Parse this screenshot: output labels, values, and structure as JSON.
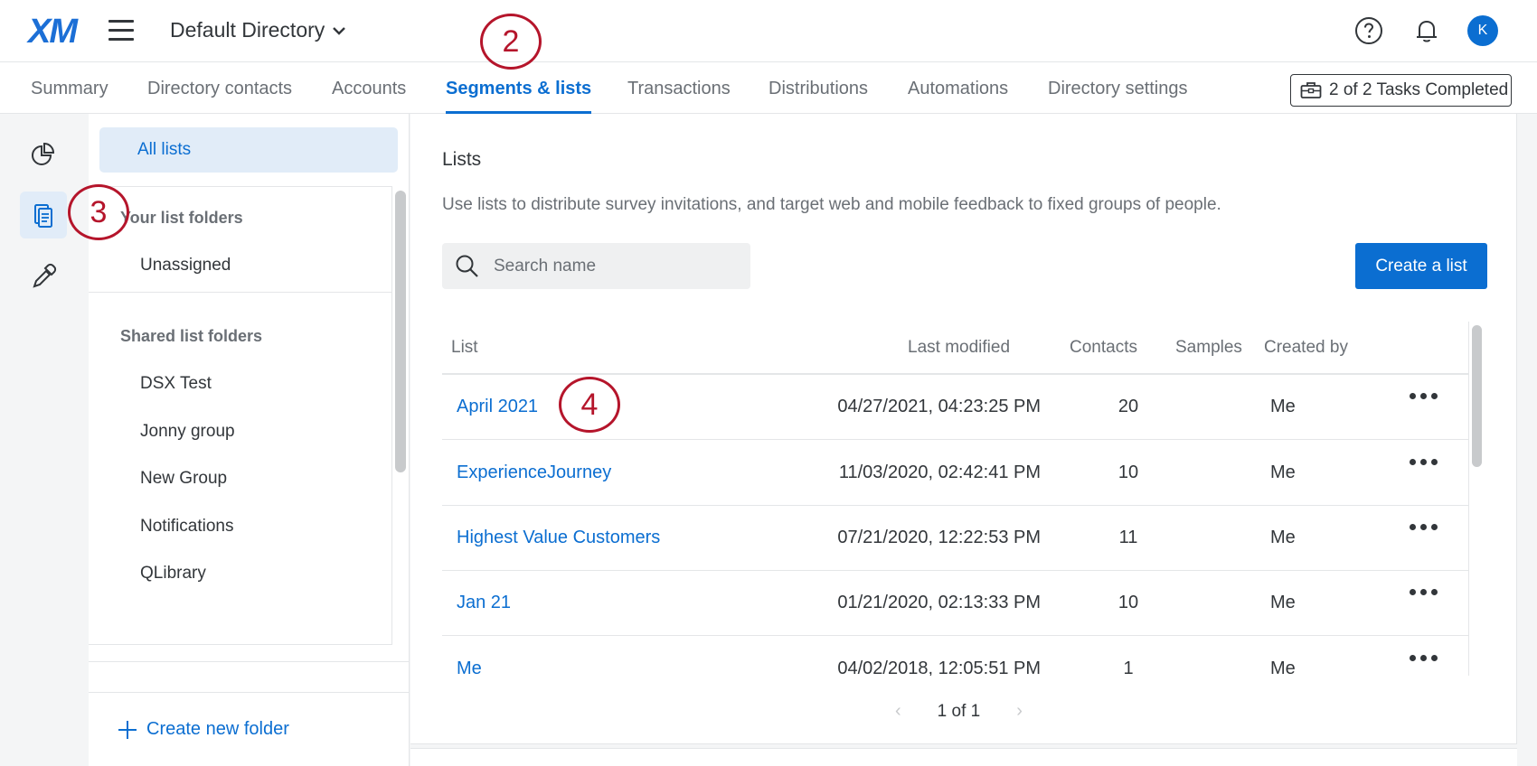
{
  "header": {
    "logo": "XM",
    "directory_name": "Default Directory",
    "avatar_initial": "K"
  },
  "tabs": [
    {
      "label": "Summary"
    },
    {
      "label": "Directory contacts"
    },
    {
      "label": "Accounts"
    },
    {
      "label": "Segments & lists",
      "active": true
    },
    {
      "label": "Transactions"
    },
    {
      "label": "Distributions"
    },
    {
      "label": "Automations"
    },
    {
      "label": "Directory settings"
    }
  ],
  "tasks_button": "2 of 2 Tasks Completed",
  "rail": {
    "items": [
      {
        "icon": "segments-pie-icon"
      },
      {
        "icon": "lists-icon",
        "active": true
      },
      {
        "icon": "eyedropper-icon"
      }
    ]
  },
  "folders": {
    "all_lists": "All lists",
    "your_heading": "Your list folders",
    "your_items": [
      "Unassigned"
    ],
    "shared_heading": "Shared list folders",
    "shared_items": [
      "DSX Test",
      "Jonny group",
      "New Group",
      "Notifications",
      "QLibrary"
    ],
    "create_folder": "Create new folder"
  },
  "main": {
    "title": "Lists",
    "description": "Use lists to distribute survey invitations, and target web and mobile feedback to fixed groups of people.",
    "search_placeholder": "Search name",
    "create_button": "Create a list",
    "columns": [
      "List",
      "Last modified",
      "Contacts",
      "Samples",
      "Created by"
    ],
    "rows": [
      {
        "name": "April 2021",
        "modified": "04/27/2021, 04:23:25 PM",
        "contacts": "20",
        "samples": "",
        "created_by": "Me"
      },
      {
        "name": "ExperienceJourney",
        "modified": "11/03/2020, 02:42:41 PM",
        "contacts": "10",
        "samples": "",
        "created_by": "Me"
      },
      {
        "name": "Highest Value Customers",
        "modified": "07/21/2020, 12:22:53 PM",
        "contacts": "11",
        "samples": "",
        "created_by": "Me"
      },
      {
        "name": "Jan 21",
        "modified": "01/21/2020, 02:13:33 PM",
        "contacts": "10",
        "samples": "",
        "created_by": "Me"
      },
      {
        "name": "Me",
        "modified": "04/02/2018, 12:05:51 PM",
        "contacts": "1",
        "samples": "",
        "created_by": "Me"
      }
    ],
    "pagination": "1 of 1"
  },
  "callouts": [
    "2",
    "3",
    "4"
  ],
  "colors": {
    "accent": "#0b6ed1",
    "callout": "#b5152b"
  }
}
